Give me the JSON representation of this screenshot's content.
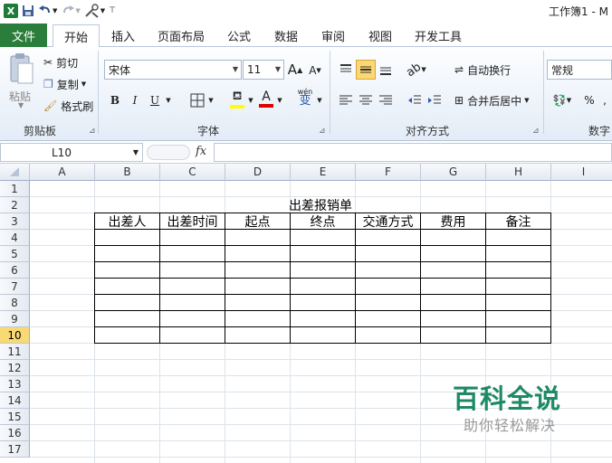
{
  "title_bar": {
    "app_icon": "excel-icon",
    "title": "工作簿1 - M"
  },
  "tabs": [
    {
      "label": "文件",
      "active": false
    },
    {
      "label": "开始",
      "active": true
    },
    {
      "label": "插入",
      "active": false
    },
    {
      "label": "页面布局",
      "active": false
    },
    {
      "label": "公式",
      "active": false
    },
    {
      "label": "数据",
      "active": false
    },
    {
      "label": "审阅",
      "active": false
    },
    {
      "label": "视图",
      "active": false
    },
    {
      "label": "开发工具",
      "active": false
    }
  ],
  "ribbon": {
    "clipboard": {
      "paste": "粘贴",
      "cut": "剪切",
      "copy": "复制",
      "format_painter": "格式刷",
      "label": "剪贴板"
    },
    "font": {
      "family": "宋体",
      "size": "11",
      "bold": "B",
      "italic": "I",
      "underline": "U",
      "grow": "A",
      "shrink": "A",
      "font_color_letter": "A",
      "phonetic": "wén",
      "phonetic_char": "变",
      "label": "字体"
    },
    "alignment": {
      "wrap_text": "自动换行",
      "merge_center": "合并后居中",
      "label": "对齐方式"
    },
    "number": {
      "format": "常规",
      "percent": "%",
      "label": "数字"
    }
  },
  "formula_bar": {
    "name_box": "L10",
    "fx": "fx",
    "content": ""
  },
  "sheet": {
    "columns": [
      "A",
      "B",
      "C",
      "D",
      "E",
      "F",
      "G",
      "H",
      "I"
    ],
    "rows": [
      "1",
      "2",
      "3",
      "4",
      "5",
      "6",
      "7",
      "8",
      "9",
      "10",
      "11",
      "12",
      "13",
      "14",
      "15",
      "16",
      "17"
    ],
    "active_row": "10",
    "form_title": "出差报销单",
    "table_headers": [
      "出差人",
      "出差时间",
      "起点",
      "终点",
      "交通方式",
      "费用",
      "备注"
    ]
  },
  "watermark": {
    "main": "百科全说",
    "sub": "助你轻松解决"
  },
  "colors": {
    "file_tab": "#2a7d3a",
    "active_row_header": "#f9d974",
    "watermark_green": "#1e8a63"
  }
}
